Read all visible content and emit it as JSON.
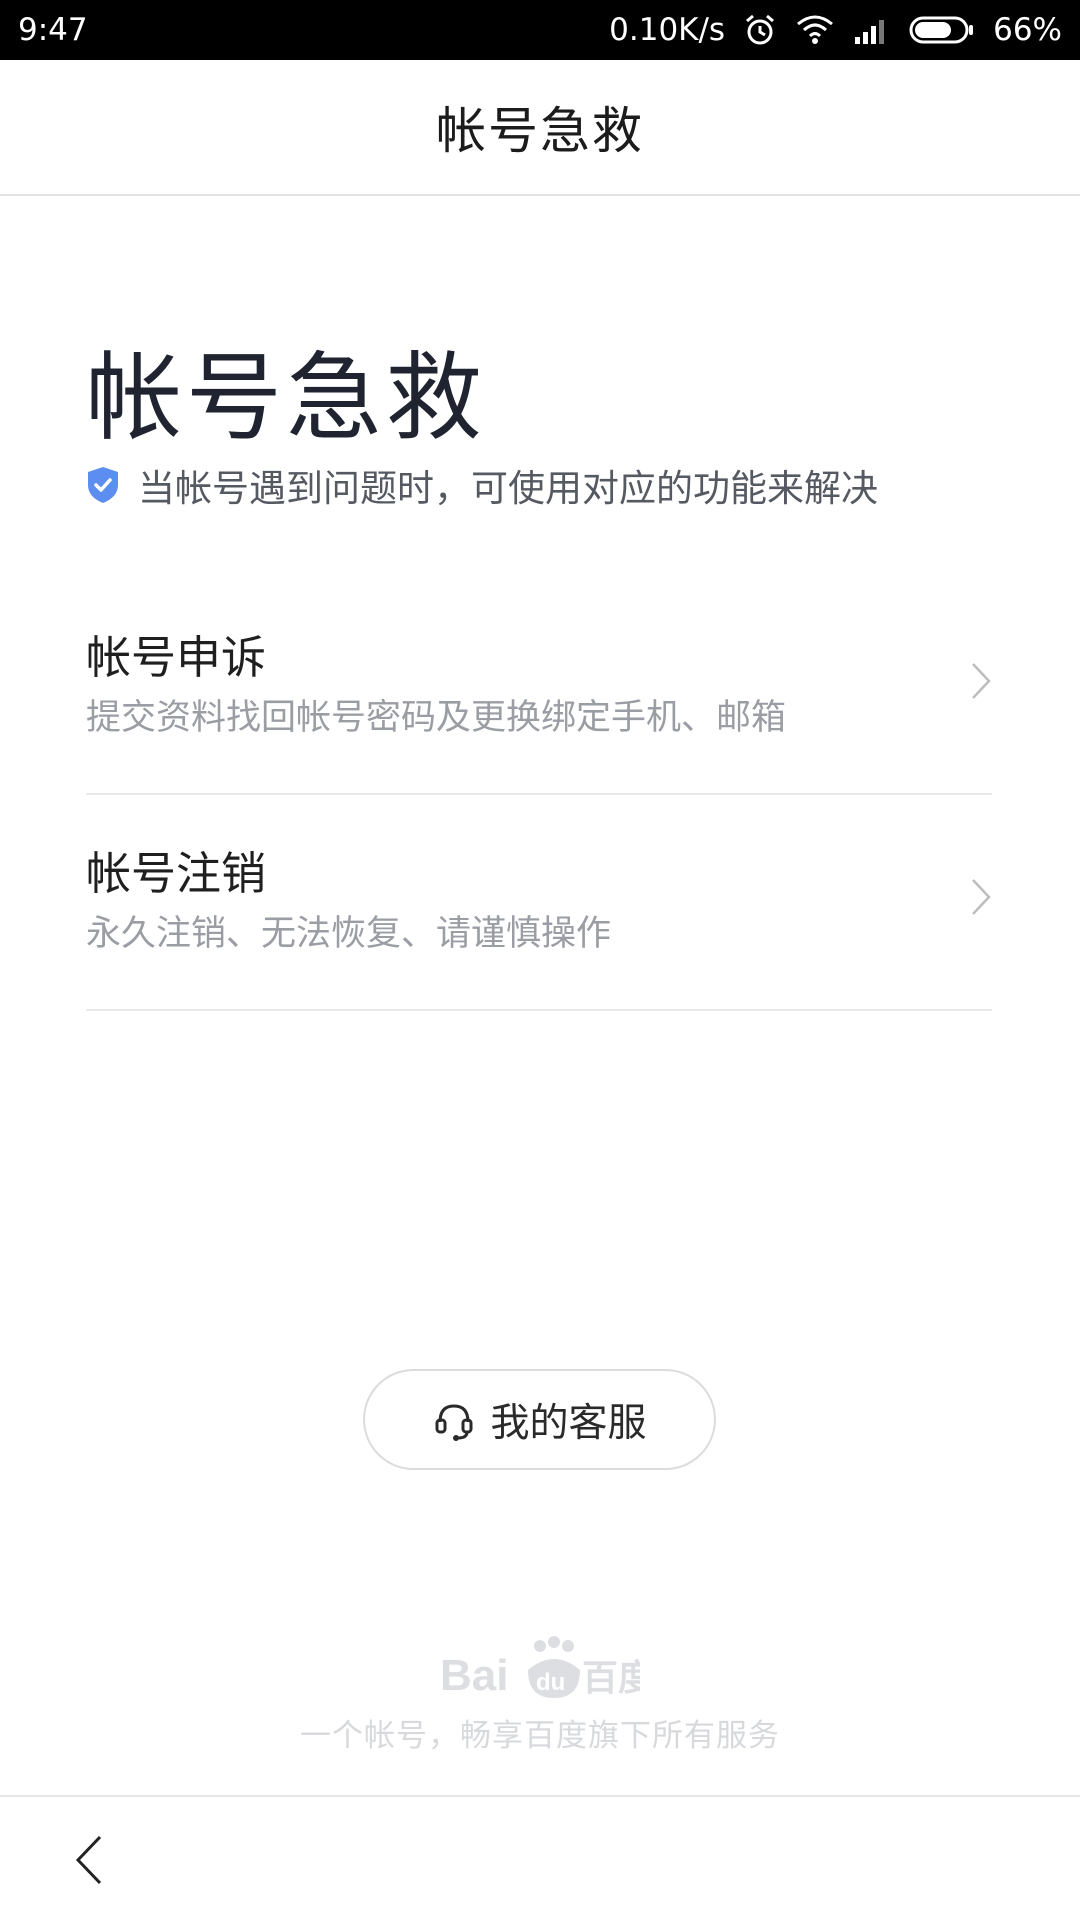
{
  "status_bar": {
    "time": "9:47",
    "net_speed": "0.10K/s",
    "battery": "66%",
    "icons": [
      "alarm-icon",
      "wifi-icon",
      "signal-icon",
      "battery-icon"
    ]
  },
  "nav": {
    "title": "帐号急救"
  },
  "hero": {
    "title": "帐号急救",
    "subtitle": "当帐号遇到问题时，可使用对应的功能来解决",
    "icon": "shield-check-icon",
    "accent": "#4a7de8"
  },
  "menu": [
    {
      "title": "帐号申诉",
      "desc": "提交资料找回帐号密码及更换绑定手机、邮箱"
    },
    {
      "title": "帐号注销",
      "desc": "永久注销、无法恢复、请谨慎操作"
    }
  ],
  "service_button": {
    "label": "我的客服",
    "icon": "headset-icon"
  },
  "footer": {
    "logo_text": "Bai du 百度",
    "slogan": "一个帐号，畅享百度旗下所有服务"
  },
  "bottom_bar": {
    "back_icon": "back-arrow-icon"
  }
}
